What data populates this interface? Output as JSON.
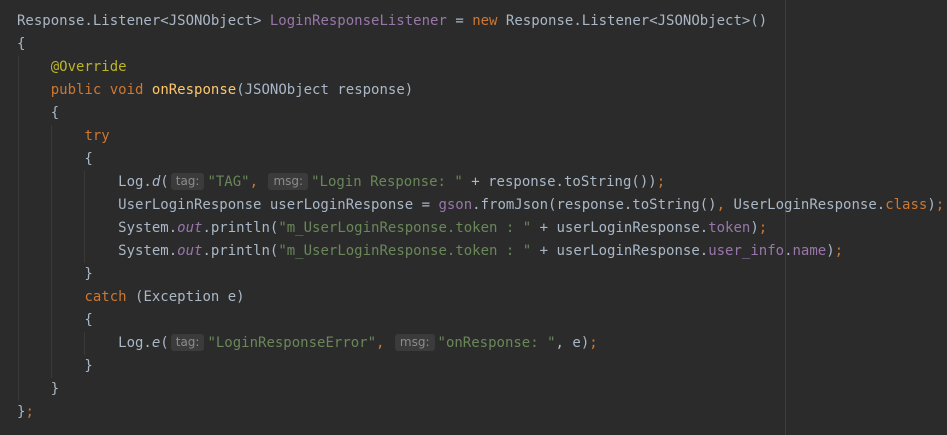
{
  "editor": {
    "lines": [
      [
        {
          "t": "Response.Listener<JSONObject> ",
          "c": ""
        },
        {
          "t": "LoginResponseListener",
          "c": "field"
        },
        {
          "t": " = ",
          "c": ""
        },
        {
          "t": "new",
          "c": "kw"
        },
        {
          "t": " Response.Listener<JSONObject>()",
          "c": ""
        }
      ],
      [
        {
          "t": "{",
          "c": ""
        }
      ],
      [
        {
          "t": "    ",
          "c": ""
        },
        {
          "t": "@Override",
          "c": "ann"
        }
      ],
      [
        {
          "t": "    ",
          "c": ""
        },
        {
          "t": "public",
          "c": "kw"
        },
        {
          "t": " ",
          "c": ""
        },
        {
          "t": "void",
          "c": "kw"
        },
        {
          "t": " ",
          "c": ""
        },
        {
          "t": "onResponse",
          "c": "fn"
        },
        {
          "t": "(JSONObject response)",
          "c": ""
        }
      ],
      [
        {
          "t": "    {",
          "c": ""
        }
      ],
      [
        {
          "t": "        ",
          "c": ""
        },
        {
          "t": "try",
          "c": "kw"
        }
      ],
      [
        {
          "t": "        {",
          "c": ""
        }
      ],
      [
        {
          "t": "            Log.",
          "c": ""
        },
        {
          "t": "d",
          "c": "italic"
        },
        {
          "t": "(",
          "c": ""
        },
        {
          "t": "tag:",
          "c": "hint"
        },
        {
          "t": "\"TAG\"",
          "c": "str"
        },
        {
          "t": ",",
          "c": "kw"
        },
        {
          "t": " ",
          "c": ""
        },
        {
          "t": "msg:",
          "c": "hint"
        },
        {
          "t": "\"Login Response: \"",
          "c": "str"
        },
        {
          "t": " + response.toString())",
          "c": ""
        },
        {
          "t": ";",
          "c": "kw"
        }
      ],
      [
        {
          "t": "            UserLoginResponse userLoginResponse = ",
          "c": ""
        },
        {
          "t": "gson",
          "c": "field"
        },
        {
          "t": ".fromJson(response.toString()",
          "c": ""
        },
        {
          "t": ",",
          "c": "kw"
        },
        {
          "t": " UserLoginResponse.",
          "c": ""
        },
        {
          "t": "class",
          "c": "kw"
        },
        {
          "t": ")",
          "c": ""
        },
        {
          "t": ";",
          "c": "kw"
        }
      ],
      [
        {
          "t": "            System.",
          "c": ""
        },
        {
          "t": "out",
          "c": "static"
        },
        {
          "t": ".println(",
          "c": ""
        },
        {
          "t": "\"m_UserLoginResponse.token : \"",
          "c": "str"
        },
        {
          "t": " + userLoginResponse.",
          "c": ""
        },
        {
          "t": "token",
          "c": "field"
        },
        {
          "t": ")",
          "c": ""
        },
        {
          "t": ";",
          "c": "kw"
        }
      ],
      [
        {
          "t": "            System.",
          "c": ""
        },
        {
          "t": "out",
          "c": "static"
        },
        {
          "t": ".println(",
          "c": ""
        },
        {
          "t": "\"m_UserLoginResponse.token : \"",
          "c": "str"
        },
        {
          "t": " + userLoginResponse.",
          "c": ""
        },
        {
          "t": "user_info",
          "c": "field"
        },
        {
          "t": ".",
          "c": ""
        },
        {
          "t": "name",
          "c": "field"
        },
        {
          "t": ")",
          "c": ""
        },
        {
          "t": ";",
          "c": "kw"
        }
      ],
      [
        {
          "t": "        }",
          "c": ""
        }
      ],
      [
        {
          "t": "        ",
          "c": ""
        },
        {
          "t": "catch",
          "c": "kw"
        },
        {
          "t": " (Exception e)",
          "c": ""
        }
      ],
      [
        {
          "t": "        {",
          "c": ""
        }
      ],
      [
        {
          "t": "            Log.",
          "c": ""
        },
        {
          "t": "e",
          "c": "italic"
        },
        {
          "t": "(",
          "c": ""
        },
        {
          "t": "tag:",
          "c": "hint"
        },
        {
          "t": "\"LoginResponseError\"",
          "c": "str"
        },
        {
          "t": ",",
          "c": "kw"
        },
        {
          "t": " ",
          "c": ""
        },
        {
          "t": "msg:",
          "c": "hint"
        },
        {
          "t": "\"onResponse: \"",
          "c": "str"
        },
        {
          "t": ", e)",
          "c": ""
        },
        {
          "t": ";",
          "c": "kw"
        }
      ],
      [
        {
          "t": "        }",
          "c": ""
        }
      ],
      [
        {
          "t": "    }",
          "c": ""
        }
      ],
      [
        {
          "t": "}",
          "c": ""
        },
        {
          "t": ";",
          "c": "kw"
        }
      ]
    ]
  },
  "colors": {
    "background": "#2b2b2b",
    "text": "#a9b7c6",
    "keyword": "#cc7832",
    "annotation": "#bbb529",
    "function": "#ffc66d",
    "string": "#6a8759",
    "field": "#9876aa",
    "hint_bg": "#3b3b3b",
    "hint_text": "#8c8c8c"
  }
}
